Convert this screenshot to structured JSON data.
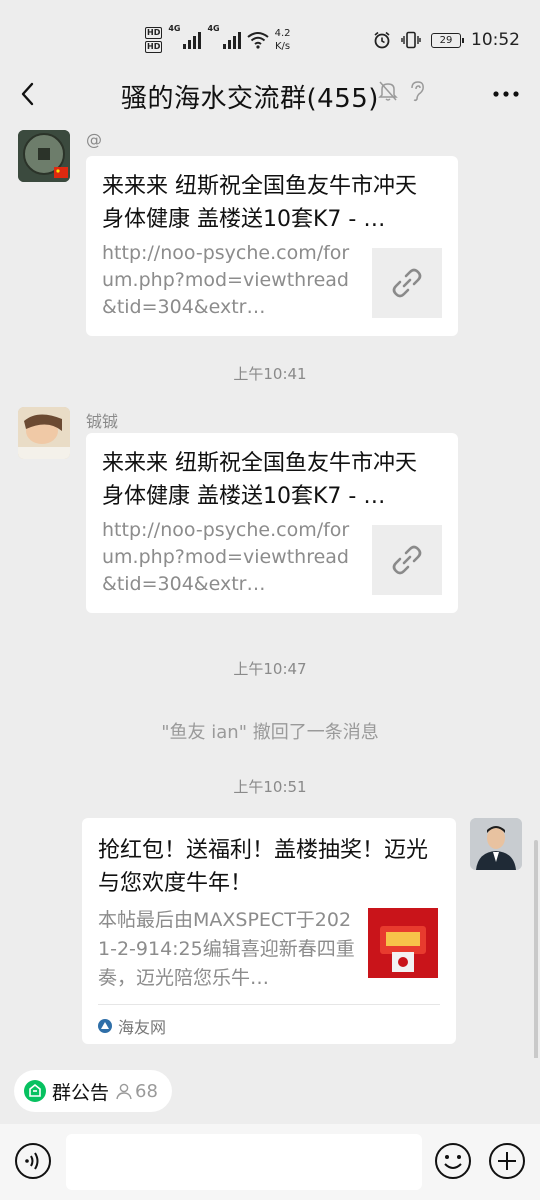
{
  "status_bar": {
    "hd1": "HD",
    "hd2": "HD",
    "net1": "4G",
    "net2": "4G",
    "speed_value": "4.2",
    "speed_unit": "K/s",
    "battery": "29",
    "time": "10:52"
  },
  "header": {
    "title": "骚的海水交流群(455)"
  },
  "messages": [
    {
      "sender": "@",
      "title": "来来来 纽斯祝全国鱼友牛市冲天 身体健康 盖楼送10套K7 - …",
      "desc": "http://noo-psyche.com/forum.php?mod=viewthread&tid=304&extr…"
    },
    {
      "sender": "铖铖",
      "title": "来来来 纽斯祝全国鱼友牛市冲天 身体健康 盖楼送10套K7 - …",
      "desc": "http://noo-psyche.com/forum.php?mod=viewthread&tid=304&extr…"
    },
    {
      "title": "抢红包！送福利！盖楼抽奖！迈光与您欢度牛年！",
      "desc": "本帖最后由MAXSPECT于2021-2-914:25编辑喜迎新春四重奏，迈光陪您乐牛…",
      "source": "海友网"
    }
  ],
  "timestamps": [
    "上午10:41",
    "上午10:47",
    "上午10:51"
  ],
  "system_message": "\"鱼友 ian\" 撤回了一条消息",
  "notice": {
    "label": "群公告",
    "count": "68"
  },
  "colors": {
    "background": "#ededed",
    "card": "#ffffff",
    "notice_green": "#07c160",
    "muted_text": "#8a8a8a"
  }
}
